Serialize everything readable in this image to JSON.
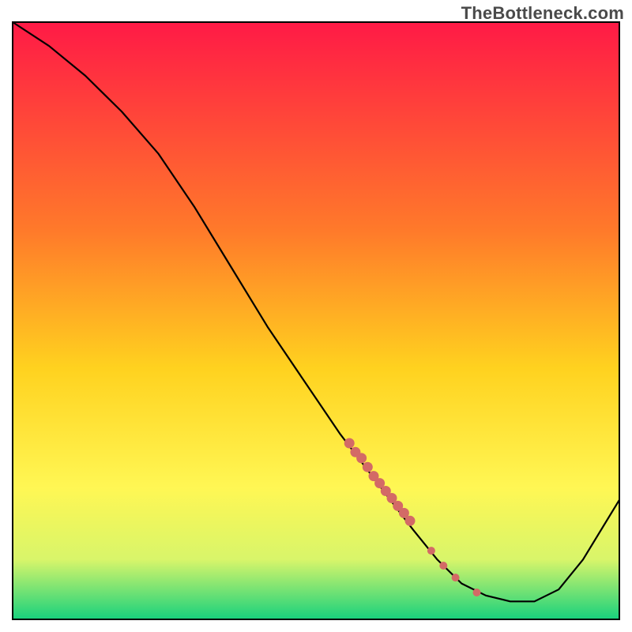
{
  "watermark": "TheBottleneck.com",
  "colors": {
    "gradient_top": "#ff1a46",
    "gradient_mid1": "#ff7a2a",
    "gradient_mid2": "#ffd21f",
    "gradient_mid3": "#fff754",
    "gradient_mid4": "#d8f56a",
    "gradient_bottom": "#17d17d",
    "line": "#000000",
    "marker": "#d36a66",
    "frame": "#000000"
  },
  "chart_data": {
    "type": "line",
    "title": "",
    "xlabel": "",
    "ylabel": "",
    "xlim": [
      0,
      100
    ],
    "ylim": [
      0,
      100
    ],
    "grid": false,
    "series": [
      {
        "name": "curve",
        "x": [
          0,
          6,
          12,
          18,
          24,
          30,
          36,
          42,
          48,
          54,
          60,
          66,
          70,
          74,
          78,
          82,
          86,
          90,
          94,
          100
        ],
        "y": [
          100,
          96,
          91,
          85,
          78,
          69,
          59,
          49,
          40,
          31,
          23,
          15,
          10,
          6,
          4,
          3,
          3,
          5,
          10,
          20
        ]
      }
    ],
    "markers": {
      "name": "highlight-points",
      "x": [
        55.5,
        56.5,
        57.5,
        58.5,
        59.5,
        60.5,
        61.5,
        62.5,
        63.5,
        64.5,
        65.5,
        69.0,
        71.0,
        73.0,
        76.5
      ],
      "y": [
        29.5,
        28.0,
        27.0,
        25.5,
        24.0,
        22.8,
        21.5,
        20.3,
        19.0,
        17.8,
        16.5,
        11.5,
        9.0,
        7.0,
        4.5
      ],
      "r": [
        6.5,
        6.5,
        6.5,
        6.5,
        6.5,
        6.5,
        6.5,
        6.5,
        6.5,
        6.5,
        6.5,
        5.0,
        5.0,
        5.0,
        5.0
      ]
    }
  }
}
